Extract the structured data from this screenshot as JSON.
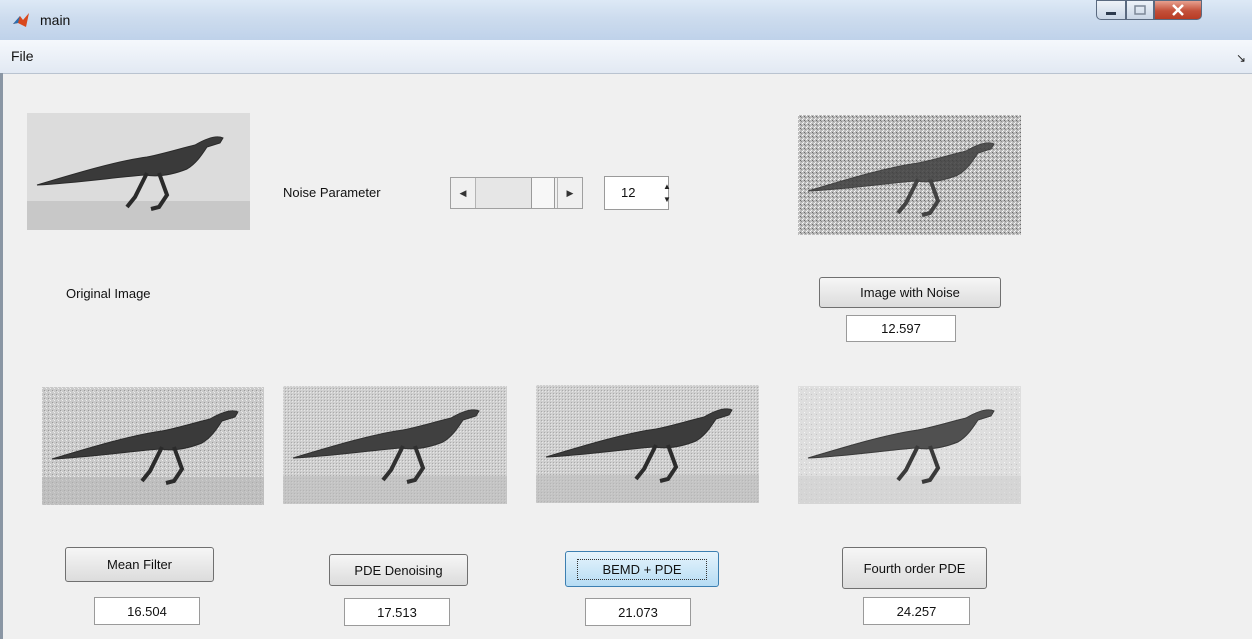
{
  "window": {
    "title": "main",
    "app_icon": "matlab-icon"
  },
  "menu": {
    "file_label": "File"
  },
  "controls": {
    "noise_label": "Noise Parameter",
    "noise_value": "12",
    "slider_level_fraction": 0.6
  },
  "original": {
    "label": "Original Image"
  },
  "noisy": {
    "button_label": "Image with Noise",
    "psnr": "12.597"
  },
  "filters": [
    {
      "button_label": "Mean Filter",
      "psnr": "16.504"
    },
    {
      "button_label": "PDE Denoising",
      "psnr": "17.513"
    },
    {
      "button_label": "BEMD + PDE",
      "psnr": "21.073"
    },
    {
      "button_label": "Fourth order PDE",
      "psnr": "24.257"
    }
  ],
  "colors": {
    "title_bar": "#cddcee",
    "close_button": "#c3503a",
    "focused_button": "#b6dcf4"
  }
}
